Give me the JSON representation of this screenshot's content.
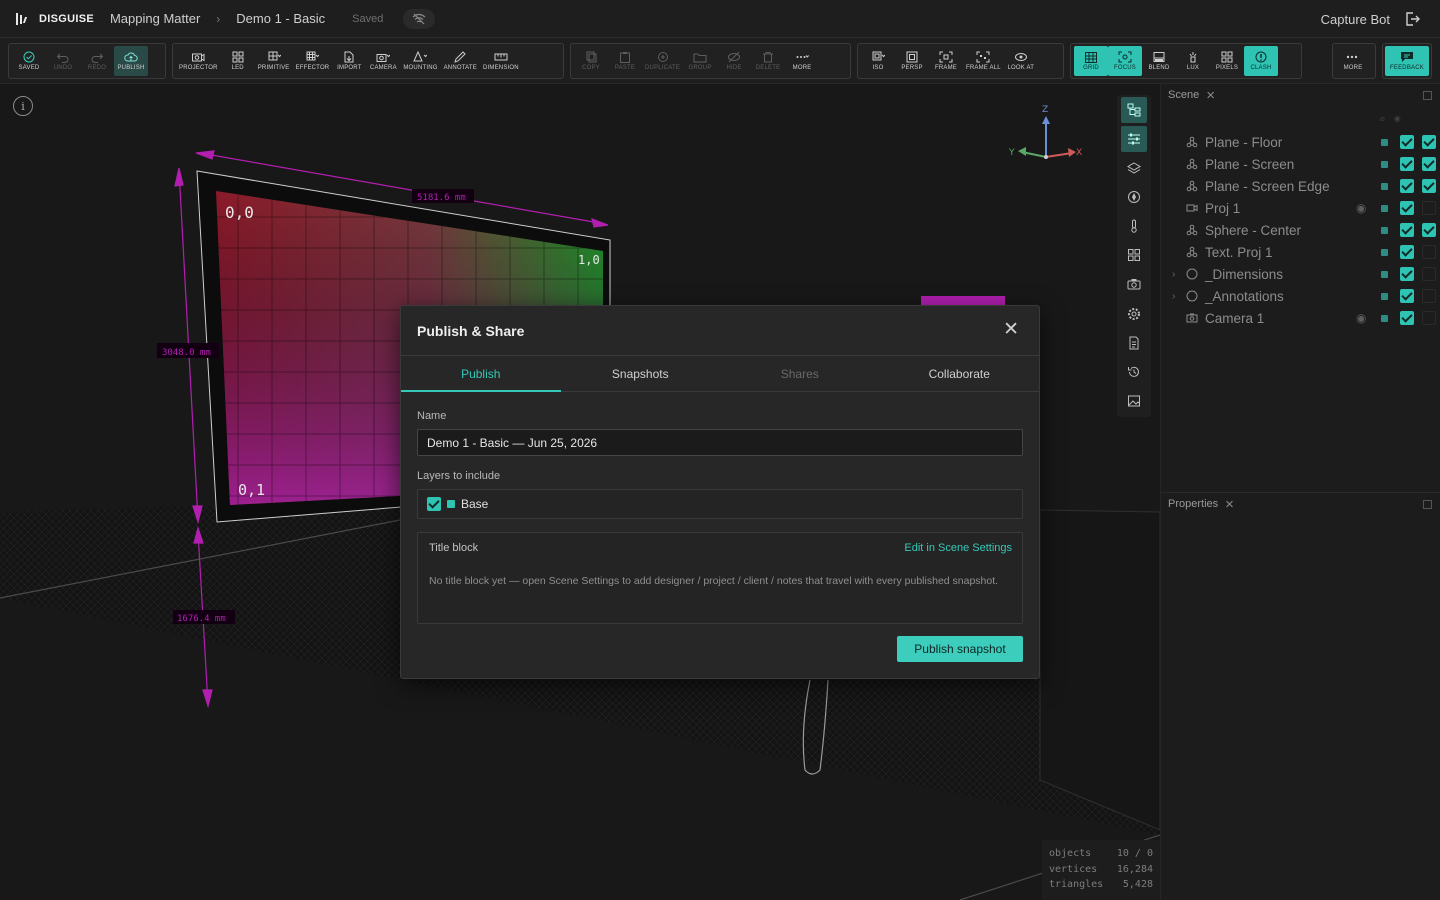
{
  "app": {
    "brand": "DISGUISE",
    "project": "Mapping Matter",
    "document": "Demo 1 - Basic",
    "save_state": "Saved",
    "user": "Capture Bot"
  },
  "toolbar": {
    "history": [
      {
        "label": "SAVED",
        "icon": "check-circle-icon",
        "state": "normal"
      },
      {
        "label": "UNDO",
        "icon": "undo-icon",
        "state": "disabled"
      },
      {
        "label": "REDO",
        "icon": "redo-icon",
        "state": "disabled"
      },
      {
        "label": "PUBLISH",
        "icon": "cloud-upload-icon",
        "state": "active"
      }
    ],
    "create": [
      {
        "label": "PROJECTOR",
        "icon": "projector-icon"
      },
      {
        "label": "LED",
        "icon": "led-grid-icon"
      },
      {
        "label": "PRIMITIVE",
        "icon": "primitive-icon"
      },
      {
        "label": "EFFECTOR",
        "icon": "effector-icon"
      },
      {
        "label": "IMPORT",
        "icon": "import-icon"
      },
      {
        "label": "CAMERA",
        "icon": "camera-icon"
      },
      {
        "label": "MOUNTING",
        "icon": "mounting-icon"
      },
      {
        "label": "ANNOTATE",
        "icon": "pen-icon"
      },
      {
        "label": "DIMENSION",
        "icon": "dimension-icon"
      }
    ],
    "edit": [
      {
        "label": "COPY",
        "icon": "copy-icon"
      },
      {
        "label": "PASTE",
        "icon": "paste-icon"
      },
      {
        "label": "DUPLICATE",
        "icon": "duplicate-icon"
      },
      {
        "label": "GROUP",
        "icon": "group-icon"
      },
      {
        "label": "HIDE",
        "icon": "hide-icon"
      },
      {
        "label": "DELETE",
        "icon": "trash-icon"
      },
      {
        "label": "MORE",
        "icon": "more-icon"
      }
    ],
    "view": [
      {
        "label": "ISO",
        "icon": "iso-icon"
      },
      {
        "label": "PERSP",
        "icon": "persp-icon"
      },
      {
        "label": "FRAME",
        "icon": "frame-icon"
      },
      {
        "label": "FRAME ALL",
        "icon": "frame-all-icon"
      },
      {
        "label": "LOOK AT",
        "icon": "eye-icon"
      }
    ],
    "overlays": [
      {
        "label": "GRID",
        "icon": "grid-icon",
        "on": true
      },
      {
        "label": "FOCUS",
        "icon": "focus-icon",
        "on": true
      },
      {
        "label": "BLEND",
        "icon": "blend-icon",
        "on": false
      },
      {
        "label": "LUX",
        "icon": "lux-icon",
        "on": false
      },
      {
        "label": "PIXELS",
        "icon": "pixels-icon",
        "on": false
      },
      {
        "label": "CLASH",
        "icon": "clash-icon",
        "on": true
      }
    ],
    "more_label": "MORE",
    "feedback_label": "FEEDBACK"
  },
  "viewport": {
    "dimensions": [
      "5181.6 mm",
      "3048.0 mm",
      "1676.4 mm"
    ],
    "screen_labels": {
      "top_left": "0,0",
      "top_right": "1,0",
      "bottom_left": "0,1"
    },
    "axes": {
      "z": "Z",
      "x": "X",
      "y": "Y"
    },
    "stats": [
      {
        "label": "objects",
        "value": "10 / 0"
      },
      {
        "label": "vertices",
        "value": "16,284"
      },
      {
        "label": "triangles",
        "value": "5,428"
      }
    ]
  },
  "scene_panel": {
    "title": "Scene",
    "items": [
      {
        "name": "Plane - Floor",
        "icon": "mesh-icon",
        "expandable": false,
        "eye": false,
        "c1": true,
        "c2": true
      },
      {
        "name": "Plane - Screen",
        "icon": "mesh-icon",
        "expandable": false,
        "eye": false,
        "c1": true,
        "c2": true
      },
      {
        "name": "Plane - Screen Edge",
        "icon": "mesh-icon",
        "expandable": false,
        "eye": false,
        "c1": true,
        "c2": true
      },
      {
        "name": "Proj 1",
        "icon": "projector-icon",
        "expandable": false,
        "eye": true,
        "c1": true,
        "c2": false
      },
      {
        "name": "Sphere - Center",
        "icon": "mesh-icon",
        "expandable": false,
        "eye": false,
        "c1": true,
        "c2": true
      },
      {
        "name": "Text. Proj 1",
        "icon": "mesh-icon",
        "expandable": false,
        "eye": false,
        "c1": true,
        "c2": false
      },
      {
        "name": "_Dimensions",
        "icon": "group-circle-icon",
        "expandable": true,
        "eye": false,
        "c1": true,
        "c2": false
      },
      {
        "name": "_Annotations",
        "icon": "group-circle-icon",
        "expandable": true,
        "eye": false,
        "c1": true,
        "c2": false
      },
      {
        "name": "Camera 1",
        "icon": "camera-icon",
        "expandable": false,
        "eye": true,
        "c1": true,
        "c2": false
      }
    ]
  },
  "properties_panel": {
    "title": "Properties"
  },
  "modal": {
    "title": "Publish & Share",
    "tabs": [
      {
        "label": "Publish",
        "state": "active"
      },
      {
        "label": "Snapshots",
        "state": "normal"
      },
      {
        "label": "Shares",
        "state": "disabled"
      },
      {
        "label": "Collaborate",
        "state": "normal"
      }
    ],
    "name_label": "Name",
    "name_value": "Demo 1 - Basic — Jun 25, 2026",
    "layers_label": "Layers to include",
    "layers": [
      {
        "name": "Base",
        "checked": true
      }
    ],
    "title_block": {
      "heading": "Title block",
      "link": "Edit in Scene Settings",
      "body": "No title block yet — open Scene Settings to add designer / project / client / notes that travel with every published snapshot."
    },
    "publish_button": "Publish snapshot"
  },
  "colors": {
    "accent": "#35c8b8",
    "dimension": "#b21fb0",
    "background": "#1b1b1b"
  }
}
